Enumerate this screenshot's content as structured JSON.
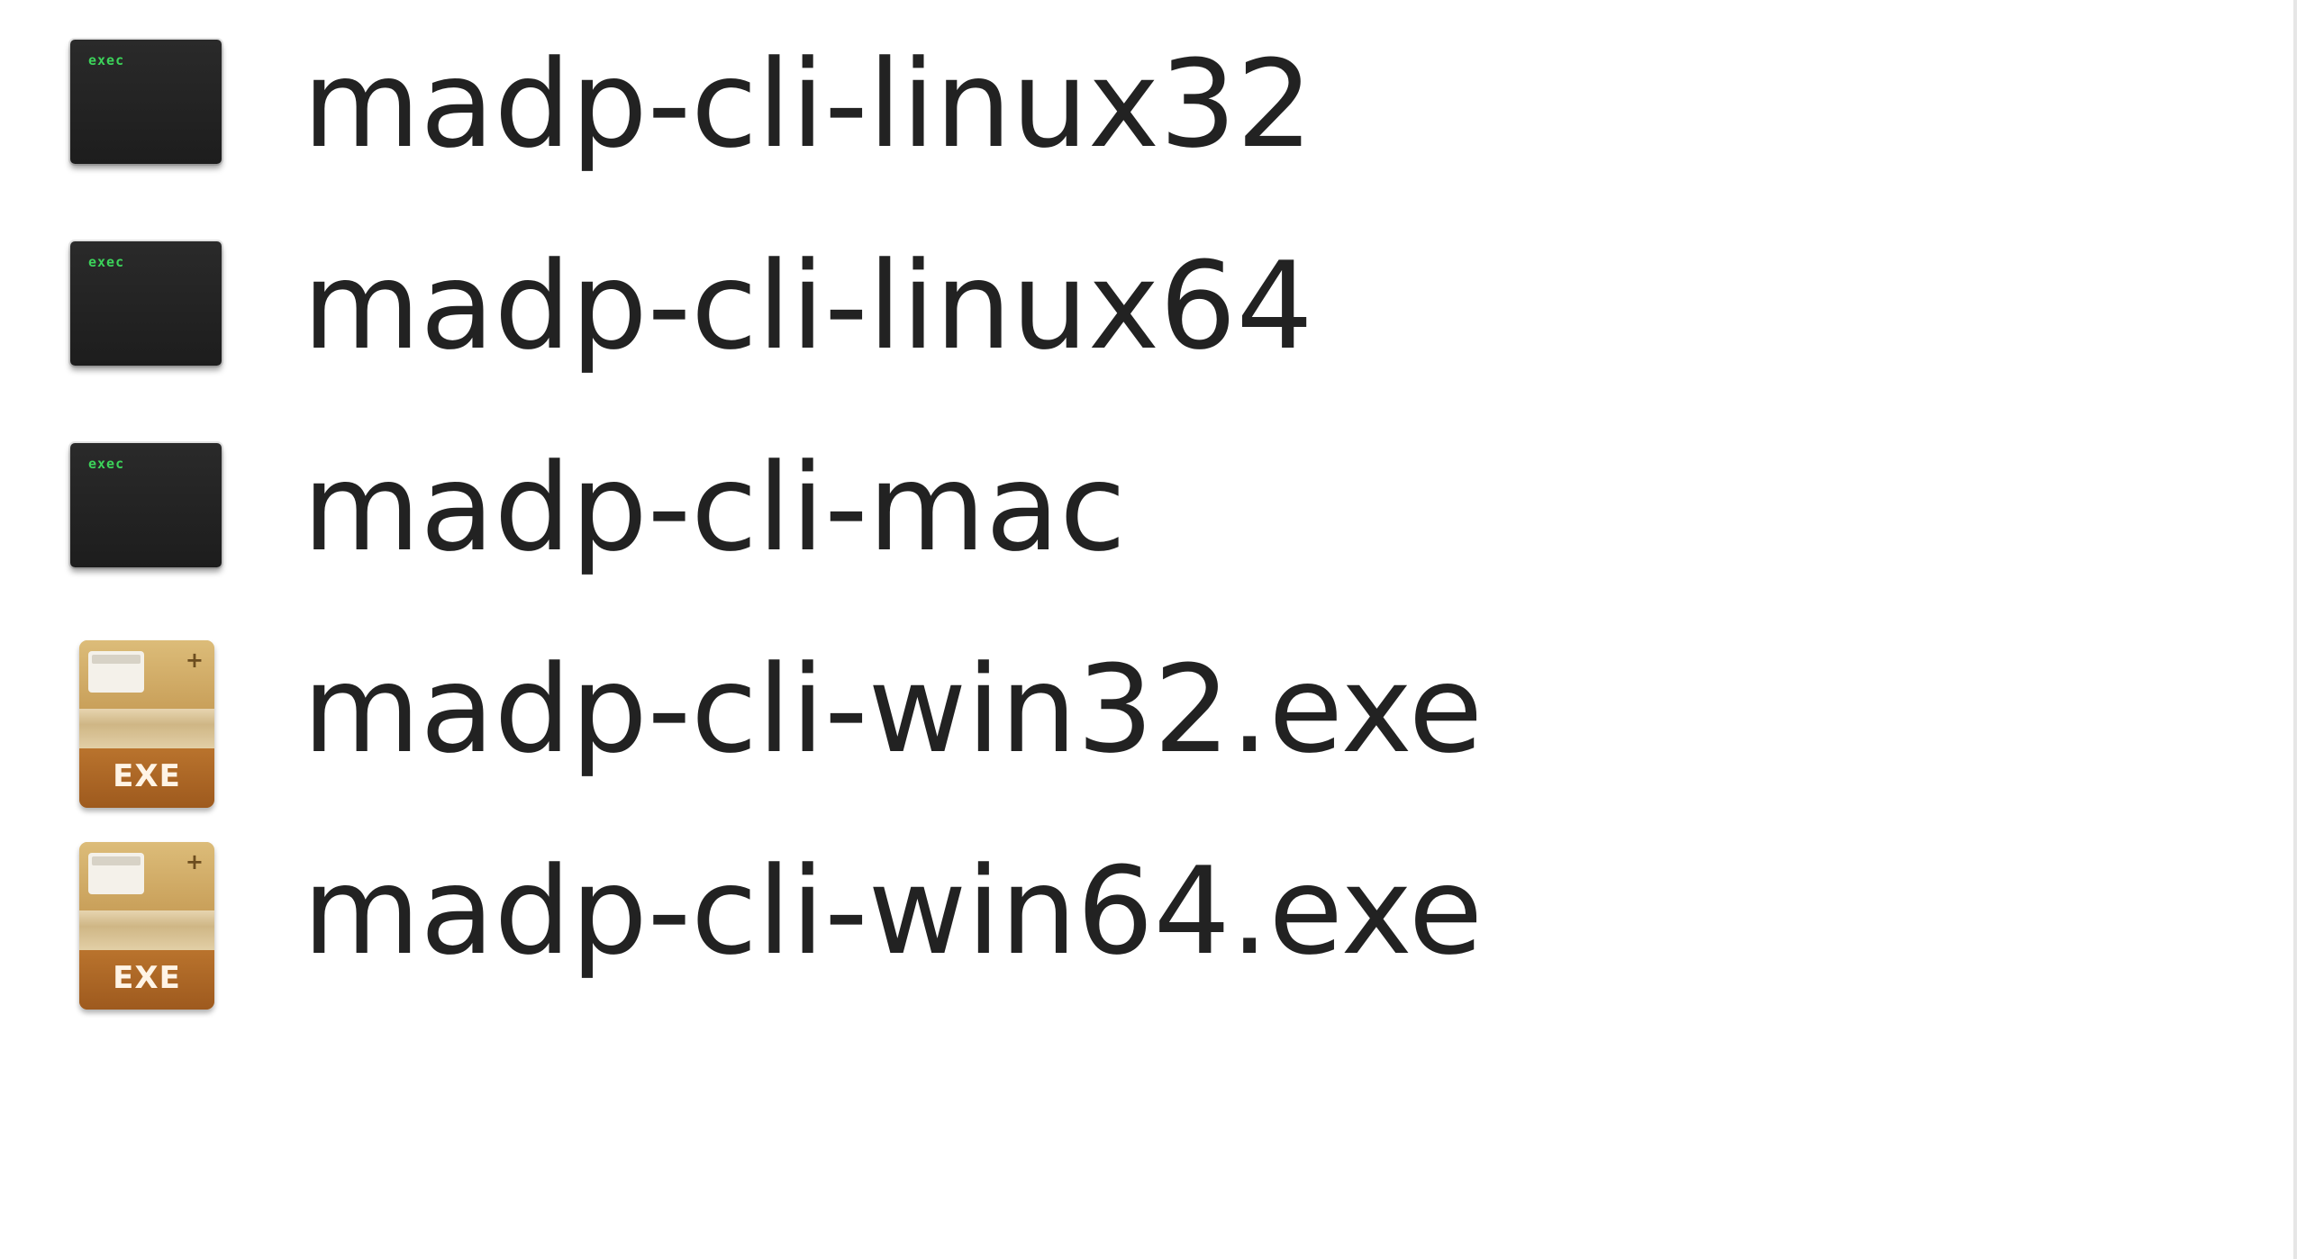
{
  "files": [
    {
      "name": "madp-cli-linux32",
      "icon": "terminal-executable-icon",
      "icon_glyph": "exec"
    },
    {
      "name": "madp-cli-linux64",
      "icon": "terminal-executable-icon",
      "icon_glyph": "exec"
    },
    {
      "name": "madp-cli-mac",
      "icon": "terminal-executable-icon",
      "icon_glyph": "exec"
    },
    {
      "name": "madp-cli-win32.exe",
      "icon": "exe-installer-icon",
      "icon_label": "EXE",
      "icon_plus": "+"
    },
    {
      "name": "madp-cli-win64.exe",
      "icon": "exe-installer-icon",
      "icon_label": "EXE",
      "icon_plus": "+"
    }
  ],
  "colors": {
    "background": "#ffffff",
    "text": "#222222",
    "terminal_icon": "#1d1d1d",
    "terminal_prompt": "#3cd35a",
    "exe_box": "#c79c52",
    "exe_label": "#9e5a1e"
  }
}
